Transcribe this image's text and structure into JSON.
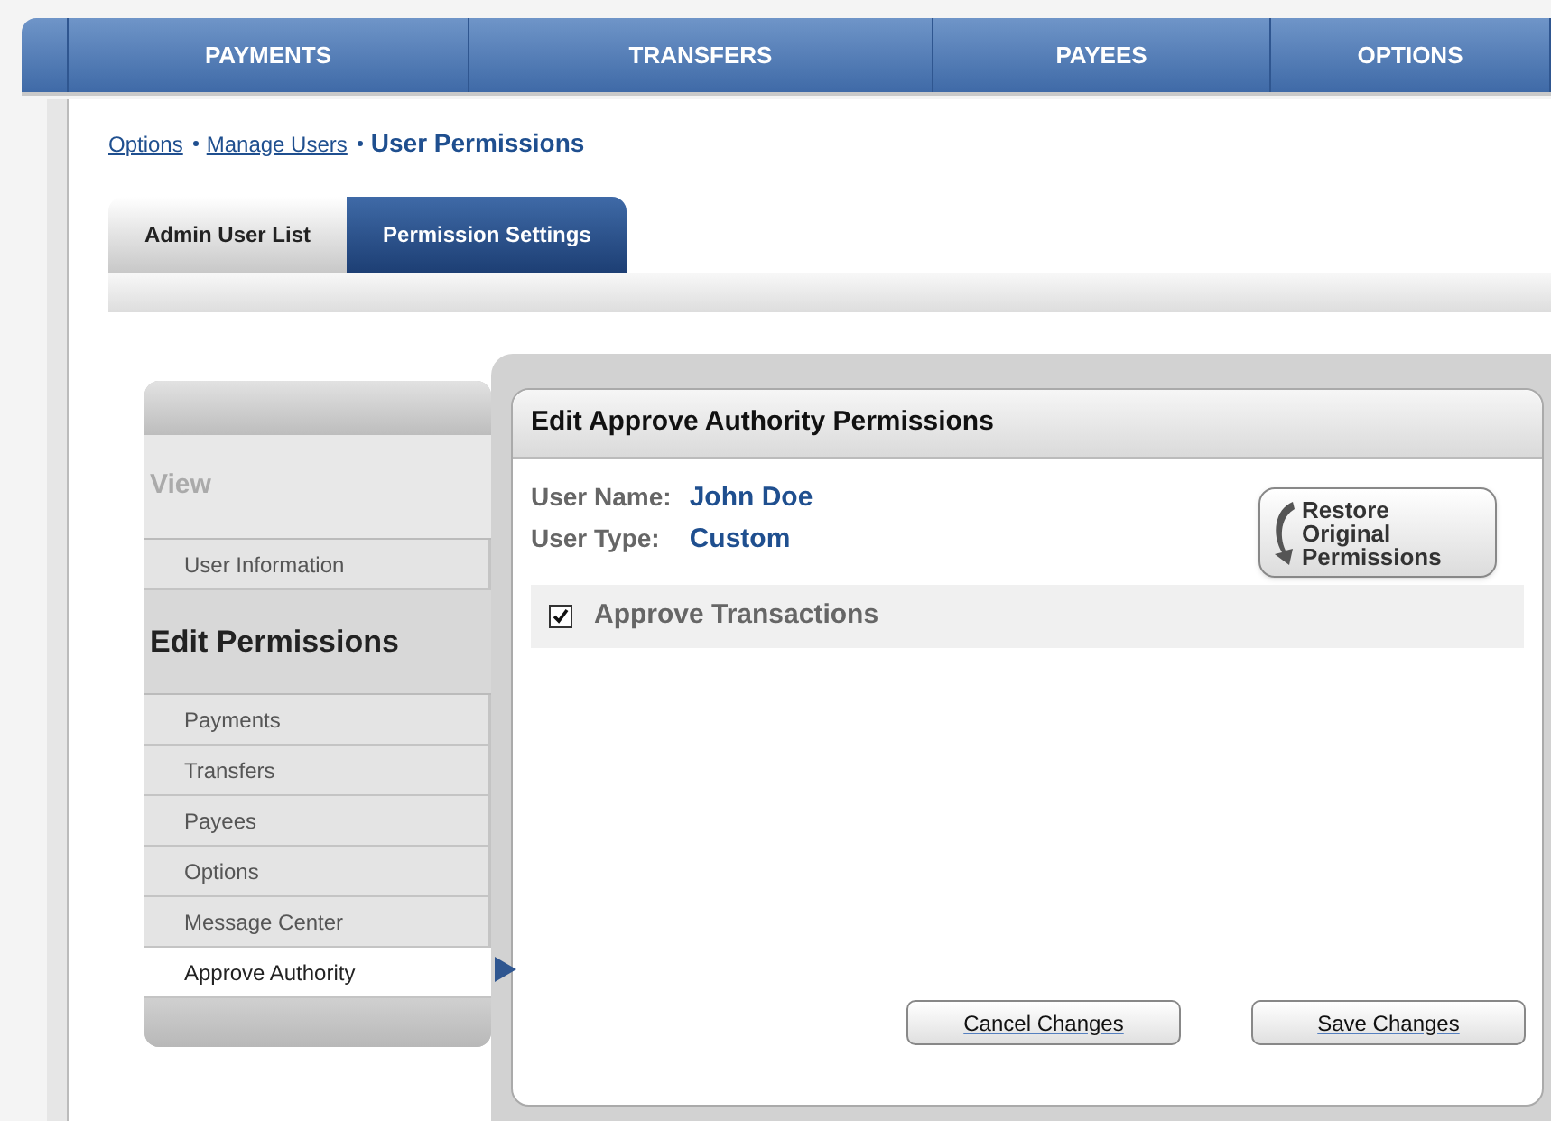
{
  "nav": [
    {
      "label": "PAYMENTS"
    },
    {
      "label": "TRANSFERS"
    },
    {
      "label": "PAYEES"
    },
    {
      "label": "OPTIONS"
    }
  ],
  "breadcrumb": [
    {
      "label": "Options",
      "kind": "link"
    },
    {
      "label": "Manage Users",
      "kind": "link"
    },
    {
      "label": "User Permissions",
      "kind": "current"
    }
  ],
  "tabs": [
    {
      "label": "Admin User List",
      "selected": false
    },
    {
      "label": "Permission Settings",
      "selected": true
    }
  ],
  "sidebar": {
    "sections": [
      {
        "title": "View",
        "active": false,
        "items": [
          {
            "label": "User Information",
            "selected": false
          }
        ]
      },
      {
        "title": "Edit Permissions",
        "active": true,
        "items": [
          {
            "label": "Payments",
            "selected": false
          },
          {
            "label": "Transfers",
            "selected": false
          },
          {
            "label": "Payees",
            "selected": false
          },
          {
            "label": "Options",
            "selected": false
          },
          {
            "label": "Message Center",
            "selected": false
          },
          {
            "label": "Approve Authority",
            "selected": true
          }
        ]
      }
    ]
  },
  "panel": {
    "title": "Edit Approve Authority Permissions",
    "fields": [
      {
        "label": "User Name:",
        "value": "John Doe"
      },
      {
        "label": "User Type:",
        "value": "Custom"
      }
    ],
    "restore_button": [
      "Restore",
      "Original",
      "Permissions"
    ],
    "permissions": [
      {
        "label": "Approve Transactions",
        "checked": true
      }
    ],
    "buttons": [
      "Cancel Changes",
      "Save Changes"
    ]
  }
}
